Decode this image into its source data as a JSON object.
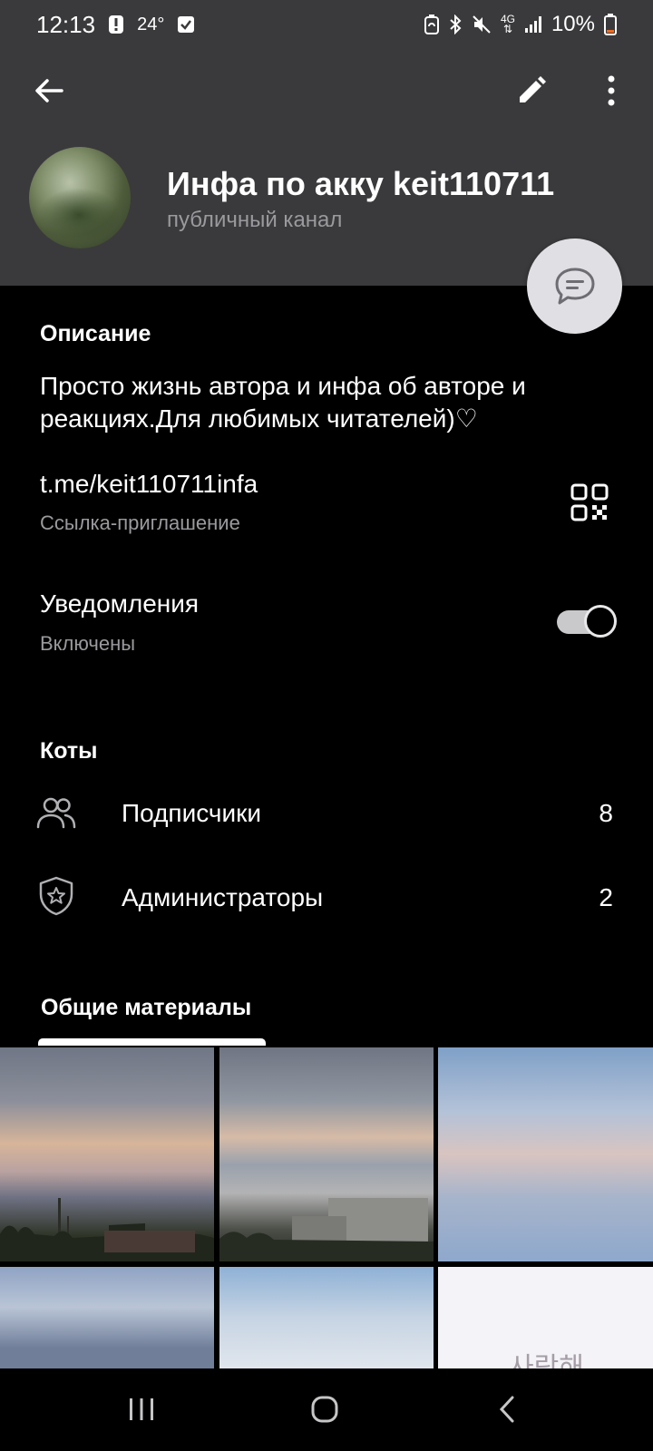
{
  "status_bar": {
    "time": "12:13",
    "temperature": "24°",
    "battery": "10%",
    "network": "4G"
  },
  "header": {
    "title": "Инфа по акку keit110711",
    "subtitle": "публичный канал"
  },
  "description": {
    "label": "Описание",
    "text": "Просто жизнь автора и инфа об авторе и реакциях.Для любимых читателей)♡"
  },
  "link": {
    "url": "t.me/keit110711infa",
    "label": "Ссылка-приглашение"
  },
  "notifications": {
    "label": "Уведомления",
    "status": "Включены",
    "enabled": true
  },
  "group": {
    "label": "Коты",
    "rows": [
      {
        "label": "Подписчики",
        "count": "8",
        "icon": "people-icon"
      },
      {
        "label": "Администраторы",
        "count": "2",
        "icon": "shield-star-icon"
      }
    ]
  },
  "media": {
    "tab_label": "Общие материалы",
    "thumbnail_text": "사랑해"
  },
  "colors": {
    "header_bg": "#3a3a3c",
    "background": "#000000",
    "secondary_text": "#9a9a9e",
    "fab_bg": "#e0dfe3"
  }
}
